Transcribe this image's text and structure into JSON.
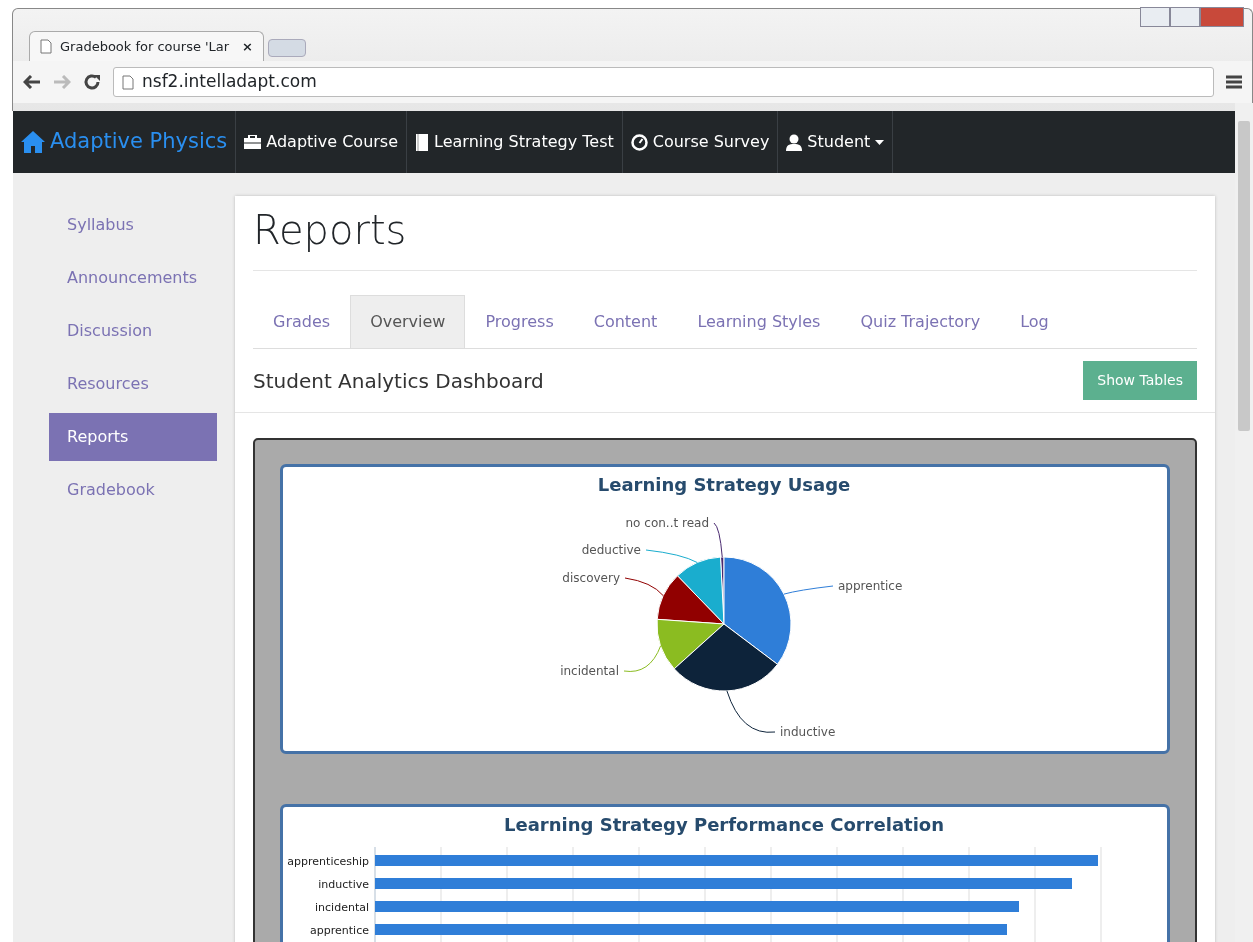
{
  "browser": {
    "tab_title": "Gradebook for course 'Lar",
    "tab_close": "×",
    "url": "nsf2.intelladapt.com"
  },
  "navbar": {
    "brand": "Adaptive Physics",
    "items": [
      {
        "label": "Adaptive Course",
        "kind": "briefcase"
      },
      {
        "label": "Learning Strategy Test",
        "kind": "book"
      },
      {
        "label": "Course Survey",
        "kind": "gauge"
      },
      {
        "label": "Student",
        "kind": "user",
        "dropdown": true
      }
    ]
  },
  "sidebar": {
    "items": [
      {
        "label": "Syllabus",
        "selected": false
      },
      {
        "label": "Announcements",
        "selected": false
      },
      {
        "label": "Discussion",
        "selected": false
      },
      {
        "label": "Resources",
        "selected": false
      },
      {
        "label": "Reports",
        "selected": true
      },
      {
        "label": "Gradebook",
        "selected": false
      }
    ]
  },
  "page": {
    "title": "Reports",
    "tabs": [
      {
        "label": "Grades",
        "selected": false
      },
      {
        "label": "Overview",
        "selected": true
      },
      {
        "label": "Progress",
        "selected": false
      },
      {
        "label": "Content",
        "selected": false
      },
      {
        "label": "Learning Styles",
        "selected": false
      },
      {
        "label": "Quiz Trajectory",
        "selected": false
      },
      {
        "label": "Log",
        "selected": false
      }
    ],
    "dashboard_title": "Student Analytics Dashboard",
    "show_tables_button": "Show Tables"
  },
  "pie_chart": {
    "title": "Learning Strategy Usage",
    "slices": [
      {
        "label": "no con..t read",
        "color": "#492970"
      },
      {
        "label": "deductive",
        "color": "#1aadce"
      },
      {
        "label": "discovery",
        "color": "#910000"
      },
      {
        "label": "apprentice",
        "color": "#2f7ed8"
      },
      {
        "label": "incidental",
        "color": "#8bbc21"
      },
      {
        "label": "inductive",
        "color": "#0d233a"
      }
    ]
  },
  "bar_chart": {
    "title": "Learning Strategy Performance Correlation",
    "categories": [
      "apprenticeship",
      "inductive",
      "incidental",
      "apprentice"
    ]
  }
}
